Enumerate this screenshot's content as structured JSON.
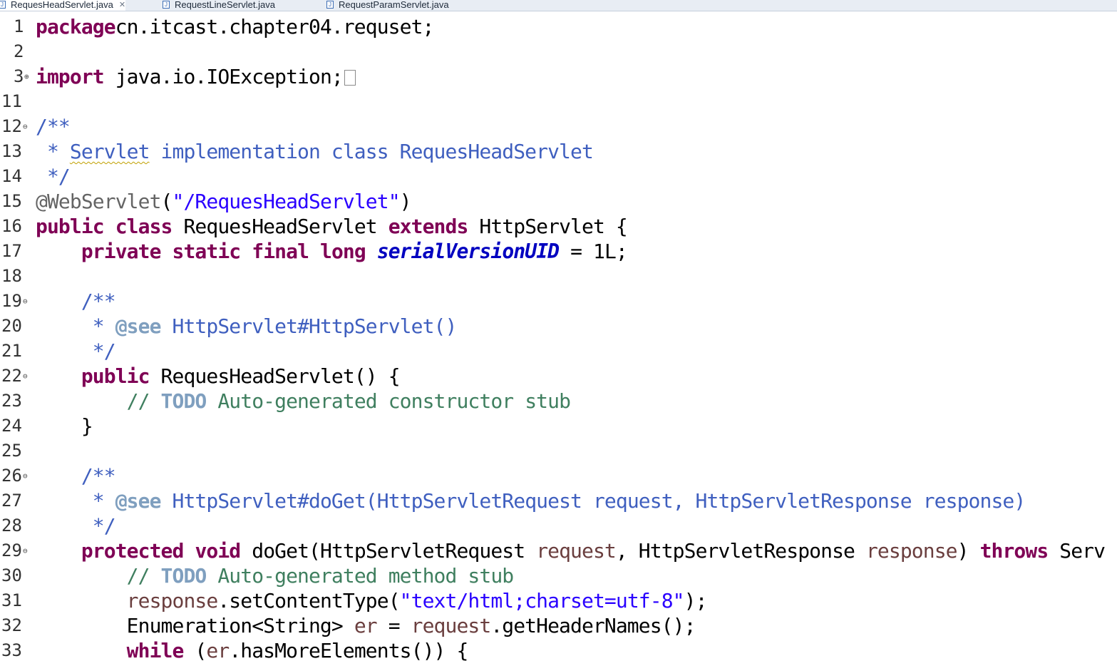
{
  "tabs": [
    {
      "label": "RequesHeadServlet.java",
      "active": true,
      "close": "✕"
    },
    {
      "label": "RequestLineServlet.java",
      "active": false
    },
    {
      "label": "RequestParamServlet.java",
      "active": false
    }
  ],
  "lines": [
    {
      "n": "1",
      "fold": "",
      "segs": [
        [
          "kw",
          "package"
        ],
        [
          "",
          "cn.itcast.chapter04.requset;"
        ]
      ]
    },
    {
      "n": "2",
      "fold": "",
      "segs": []
    },
    {
      "n": "3",
      "fold": "⊕",
      "segs": [
        [
          "kw",
          "import"
        ],
        [
          "",
          " java.io.IOException;"
        ]
      ],
      "collapsed": true
    },
    {
      "n": "11",
      "fold": "",
      "segs": []
    },
    {
      "n": "12",
      "fold": "⊖",
      "segs": [
        [
          "jd",
          "/**"
        ]
      ]
    },
    {
      "n": "13",
      "fold": "",
      "segs": [
        [
          "jd",
          " * "
        ],
        [
          "jd squiggle",
          "Servlet"
        ],
        [
          "jd",
          " implementation class RequesHeadServlet"
        ]
      ]
    },
    {
      "n": "14",
      "fold": "",
      "segs": [
        [
          "jd",
          " */"
        ]
      ]
    },
    {
      "n": "15",
      "fold": "",
      "segs": [
        [
          "ann",
          "@WebServlet"
        ],
        [
          "",
          "("
        ],
        [
          "str",
          "\"/RequesHeadServlet\""
        ],
        [
          "",
          ")"
        ]
      ]
    },
    {
      "n": "16",
      "fold": "",
      "segs": [
        [
          "kw",
          "public"
        ],
        [
          "",
          " "
        ],
        [
          "kw",
          "class"
        ],
        [
          "",
          " RequesHeadServlet "
        ],
        [
          "kw",
          "extends"
        ],
        [
          "",
          " HttpServlet {"
        ]
      ]
    },
    {
      "n": "17",
      "fold": "",
      "segs": [
        [
          "",
          "    "
        ],
        [
          "kw",
          "private"
        ],
        [
          "",
          " "
        ],
        [
          "kw",
          "static"
        ],
        [
          "",
          " "
        ],
        [
          "kw",
          "final"
        ],
        [
          "",
          " "
        ],
        [
          "kw",
          "long"
        ],
        [
          "",
          " "
        ],
        [
          "sf",
          "serialVersionUID"
        ],
        [
          "",
          " = 1L;"
        ]
      ]
    },
    {
      "n": "18",
      "fold": "",
      "segs": []
    },
    {
      "n": "19",
      "fold": "⊖",
      "segs": [
        [
          "",
          "    "
        ],
        [
          "jd",
          "/**"
        ]
      ]
    },
    {
      "n": "20",
      "fold": "",
      "segs": [
        [
          "",
          "    "
        ],
        [
          "jd",
          " * "
        ],
        [
          "jdtag",
          "@see"
        ],
        [
          "jd",
          " HttpServlet#HttpServlet()"
        ]
      ]
    },
    {
      "n": "21",
      "fold": "",
      "segs": [
        [
          "",
          "    "
        ],
        [
          "jd",
          " */"
        ]
      ]
    },
    {
      "n": "22",
      "fold": "⊖",
      "segs": [
        [
          "",
          "    "
        ],
        [
          "kw",
          "public"
        ],
        [
          "",
          " RequesHeadServlet() {"
        ]
      ]
    },
    {
      "n": "23",
      "fold": "",
      "segs": [
        [
          "",
          "        "
        ],
        [
          "cm",
          "// "
        ],
        [
          "todo",
          "TODO"
        ],
        [
          "cm",
          " Auto-generated constructor stub"
        ]
      ]
    },
    {
      "n": "24",
      "fold": "",
      "segs": [
        [
          "",
          "    }"
        ]
      ]
    },
    {
      "n": "25",
      "fold": "",
      "segs": []
    },
    {
      "n": "26",
      "fold": "⊖",
      "segs": [
        [
          "",
          "    "
        ],
        [
          "jd",
          "/**"
        ]
      ]
    },
    {
      "n": "27",
      "fold": "",
      "segs": [
        [
          "",
          "    "
        ],
        [
          "jd",
          " * "
        ],
        [
          "jdtag",
          "@see"
        ],
        [
          "jd",
          " HttpServlet#doGet(HttpServletRequest request, HttpServletResponse response)"
        ]
      ]
    },
    {
      "n": "28",
      "fold": "",
      "segs": [
        [
          "",
          "    "
        ],
        [
          "jd",
          " */"
        ]
      ]
    },
    {
      "n": "29",
      "fold": "⊖",
      "segs": [
        [
          "",
          "    "
        ],
        [
          "kw",
          "protected"
        ],
        [
          "",
          " "
        ],
        [
          "kw",
          "void"
        ],
        [
          "",
          " doGet(HttpServletRequest "
        ],
        [
          "par",
          "request"
        ],
        [
          "",
          ", HttpServletResponse "
        ],
        [
          "par",
          "response"
        ],
        [
          "",
          ") "
        ],
        [
          "kw",
          "throws"
        ],
        [
          "",
          " Serv"
        ]
      ]
    },
    {
      "n": "30",
      "fold": "",
      "segs": [
        [
          "",
          "        "
        ],
        [
          "cm",
          "// "
        ],
        [
          "todo",
          "TODO"
        ],
        [
          "cm",
          " Auto-generated method stub"
        ]
      ]
    },
    {
      "n": "31",
      "fold": "",
      "segs": [
        [
          "",
          "        "
        ],
        [
          "par",
          "response"
        ],
        [
          "",
          ".setContentType("
        ],
        [
          "str",
          "\"text/html;charset=utf-8\""
        ],
        [
          "",
          ");"
        ]
      ]
    },
    {
      "n": "32",
      "fold": "",
      "segs": [
        [
          "",
          "        Enumeration<String> "
        ],
        [
          "par",
          "er"
        ],
        [
          "",
          " = "
        ],
        [
          "par",
          "request"
        ],
        [
          "",
          ".getHeaderNames();"
        ]
      ]
    },
    {
      "n": "33",
      "fold": "",
      "segs": [
        [
          "",
          "        "
        ],
        [
          "kw",
          "while"
        ],
        [
          "",
          " ("
        ],
        [
          "par",
          "er"
        ],
        [
          "",
          ".hasMoreElements()) {"
        ]
      ]
    }
  ]
}
